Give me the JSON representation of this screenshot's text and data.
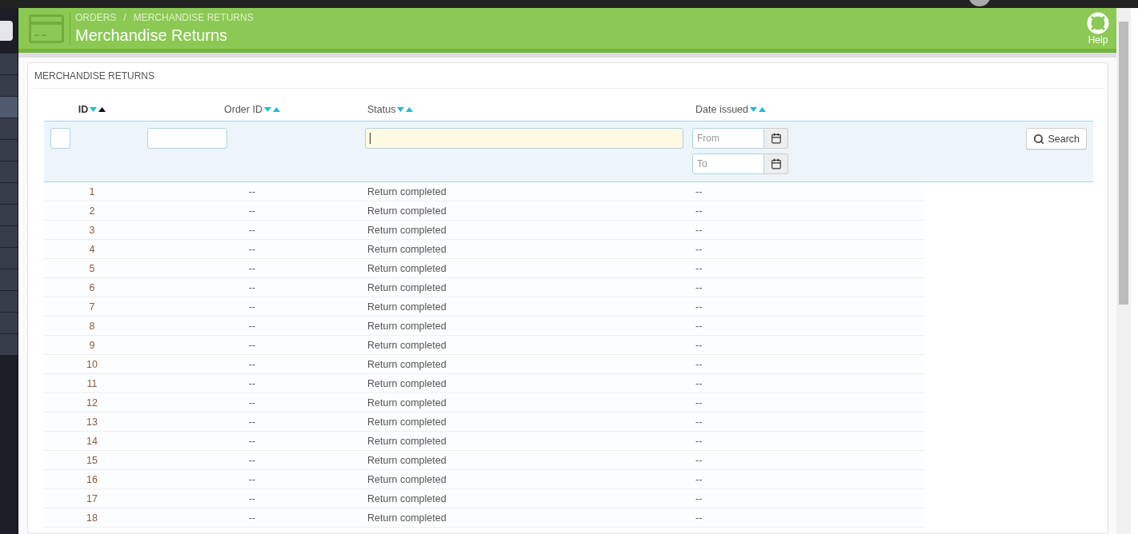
{
  "sidebar": {
    "items": [
      {
        "selected": false
      },
      {
        "selected": false
      },
      {
        "selected": true
      },
      {
        "selected": false
      },
      {
        "selected": false
      },
      {
        "selected": false
      },
      {
        "selected": false
      },
      {
        "selected": false
      },
      {
        "selected": false
      },
      {
        "selected": false
      },
      {
        "selected": false
      },
      {
        "selected": false
      },
      {
        "selected": false
      },
      {
        "selected": false
      }
    ]
  },
  "header": {
    "breadcrumb": [
      "ORDERS",
      "MERCHANDISE RETURNS"
    ],
    "breadcrumb_separator": "/",
    "title": "Merchandise Returns",
    "help": "Help"
  },
  "panel": {
    "title": "MERCHANDISE RETURNS"
  },
  "table": {
    "columns": [
      {
        "label": "ID",
        "sorted_ascending": true,
        "kind": "small"
      },
      {
        "label": "Order ID",
        "sorted_ascending": false,
        "kind": "text"
      },
      {
        "label": "Status",
        "sorted_ascending": false,
        "kind": "focused"
      },
      {
        "label": "Date issued",
        "sorted_ascending": false,
        "kind": "date"
      }
    ],
    "date_filter": {
      "from_placeholder": "From",
      "to_placeholder": "To"
    },
    "search_button": "Search",
    "rows": [
      [
        "1",
        "--",
        "Return completed",
        "--"
      ],
      [
        "2",
        "--",
        "Return completed",
        "--"
      ],
      [
        "3",
        "--",
        "Return completed",
        "--"
      ],
      [
        "4",
        "--",
        "Return completed",
        "--"
      ],
      [
        "5",
        "--",
        "Return completed",
        "--"
      ],
      [
        "6",
        "--",
        "Return completed",
        "--"
      ],
      [
        "7",
        "--",
        "Return completed",
        "--"
      ],
      [
        "8",
        "--",
        "Return completed",
        "--"
      ],
      [
        "9",
        "--",
        "Return completed",
        "--"
      ],
      [
        "10",
        "--",
        "Return completed",
        "--"
      ],
      [
        "11",
        "--",
        "Return completed",
        "--"
      ],
      [
        "12",
        "--",
        "Return completed",
        "--"
      ],
      [
        "13",
        "--",
        "Return completed",
        "--"
      ],
      [
        "14",
        "--",
        "Return completed",
        "--"
      ],
      [
        "15",
        "--",
        "Return completed",
        "--"
      ],
      [
        "16",
        "--",
        "Return completed",
        "--"
      ],
      [
        "17",
        "--",
        "Return completed",
        "--"
      ],
      [
        "18",
        "--",
        "Return completed",
        "--"
      ]
    ]
  }
}
